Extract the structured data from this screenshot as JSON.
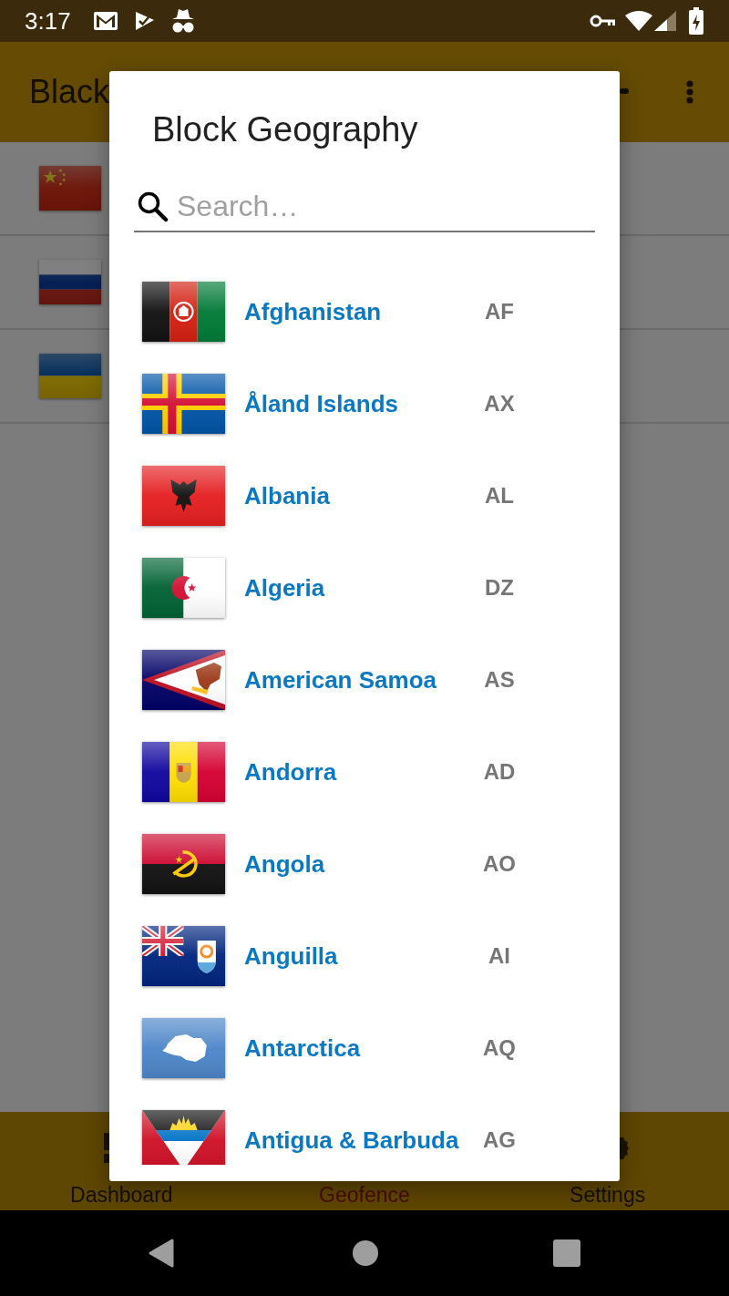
{
  "status_bar": {
    "time": "3:17"
  },
  "app_bar": {
    "title": "Black"
  },
  "dialog": {
    "title": "Block Geography",
    "search": {
      "placeholder": "Search…"
    },
    "countries": [
      {
        "name": "Afghanistan",
        "code": "AF"
      },
      {
        "name": "Åland Islands",
        "code": "AX"
      },
      {
        "name": "Albania",
        "code": "AL"
      },
      {
        "name": "Algeria",
        "code": "DZ"
      },
      {
        "name": "American Samoa",
        "code": "AS"
      },
      {
        "name": "Andorra",
        "code": "AD"
      },
      {
        "name": "Angola",
        "code": "AO"
      },
      {
        "name": "Anguilla",
        "code": "AI"
      },
      {
        "name": "Antarctica",
        "code": "AQ"
      },
      {
        "name": "Antigua & Barbuda",
        "code": "AG"
      }
    ]
  },
  "bottom_nav": [
    {
      "label": "Dashboard",
      "selected": false
    },
    {
      "label": "Geofence",
      "selected": true
    },
    {
      "label": "Settings",
      "selected": false
    }
  ]
}
